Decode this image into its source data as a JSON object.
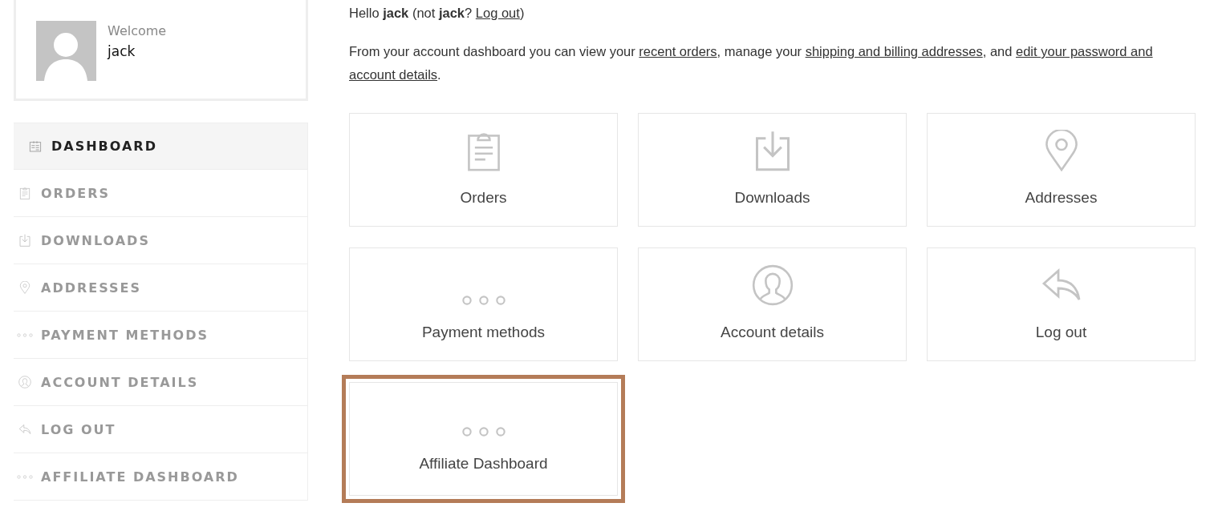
{
  "profile": {
    "greeting": "Welcome",
    "username": "jack"
  },
  "sidebar": {
    "items": [
      {
        "label": "DASHBOARD",
        "kind": "dashboard",
        "selected": true
      },
      {
        "label": "ORDERS",
        "kind": "orders",
        "selected": false
      },
      {
        "label": "DOWNLOADS",
        "kind": "downloads",
        "selected": false
      },
      {
        "label": "ADDRESSES",
        "kind": "addresses",
        "selected": false
      },
      {
        "label": "PAYMENT METHODS",
        "kind": "dots",
        "selected": false
      },
      {
        "label": "ACCOUNT DETAILS",
        "kind": "account",
        "selected": false
      },
      {
        "label": "LOG OUT",
        "kind": "logout",
        "selected": false
      },
      {
        "label": "AFFILIATE DASHBOARD",
        "kind": "dots",
        "selected": false
      }
    ]
  },
  "intro": [
    [
      {
        "kind": "text",
        "text": "Hello **jack** (not **jack**? "
      },
      {
        "kind": "link",
        "text": "Log out"
      },
      {
        "kind": "text",
        "text": ")"
      }
    ],
    [
      {
        "kind": "text",
        "text": "From your account dashboard you can view your "
      },
      {
        "kind": "link",
        "text": "recent orders"
      },
      {
        "kind": "text",
        "text": ", manage your "
      },
      {
        "kind": "link",
        "text": "shipping and billing addresses"
      },
      {
        "kind": "text",
        "text": ", and "
      },
      {
        "kind": "link",
        "text": "edit your password and"
      },
      {
        "kind": "link",
        "text": "account details"
      },
      {
        "kind": "text",
        "text": "."
      }
    ]
  ],
  "tiles": [
    {
      "label": "Orders",
      "kind": "orders",
      "highlighted": false
    },
    {
      "label": "Downloads",
      "kind": "downloads",
      "highlighted": false
    },
    {
      "label": "Addresses",
      "kind": "addresses",
      "highlighted": false
    },
    {
      "label": "Payment methods",
      "kind": "dots",
      "highlighted": false
    },
    {
      "label": "Account details",
      "kind": "account",
      "highlighted": false
    },
    {
      "label": "Log out",
      "kind": "logout",
      "highlighted": false
    },
    {
      "label": "Affiliate Dashboard",
      "kind": "dots",
      "highlighted": true
    }
  ]
}
